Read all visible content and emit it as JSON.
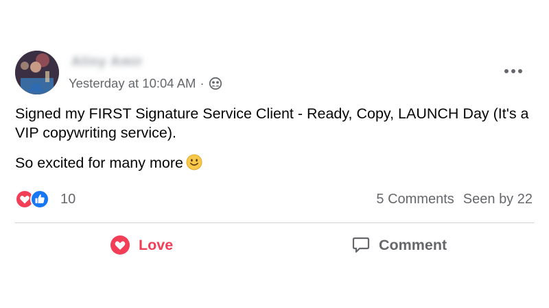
{
  "post": {
    "author_name": "Aliny Amir",
    "timestamp": "Yesterday at 10:04 AM",
    "separator": "·",
    "audience_icon": "group-icon",
    "more_icon": "more-options-icon",
    "text_line1": "Signed my FIRST Signature Service Client - Ready, Copy, LAUNCH Day (It's a VIP copywriting service).",
    "text_line2": "So excited for many more",
    "emoji": "slightly-smiling-face",
    "reaction_count": "10",
    "reaction_icons": [
      "love-icon",
      "like-icon"
    ],
    "comments_label": "5 Comments",
    "seen_label": "Seen by 22"
  },
  "actions": {
    "love_label": "Love",
    "comment_label": "Comment"
  },
  "colors": {
    "love": "#f33e58",
    "like": "#1877f2",
    "secondary_text": "#65676b",
    "divider": "#ced0d4"
  }
}
